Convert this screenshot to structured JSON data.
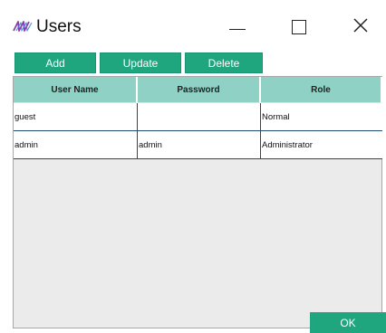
{
  "window": {
    "title": "Users",
    "icon": "stylized-waves-logo-icon",
    "controls": {
      "minimize": "minimize-icon",
      "maximize": "maximize-icon",
      "close": "close-icon"
    }
  },
  "toolbar": {
    "add_label": "Add",
    "update_label": "Update",
    "delete_label": "Delete"
  },
  "table": {
    "headers": [
      "User Name",
      "Password",
      "Role"
    ],
    "rows": [
      [
        "guest",
        "",
        "Normal"
      ],
      [
        "admin",
        "admin",
        "Administrator"
      ]
    ]
  },
  "footer": {
    "ok_label": "OK"
  },
  "colors": {
    "accent": "#1fa67f",
    "header_bg": "#8fd2c5",
    "row_border": "#1e4a73",
    "empty_area": "#ebebeb"
  }
}
